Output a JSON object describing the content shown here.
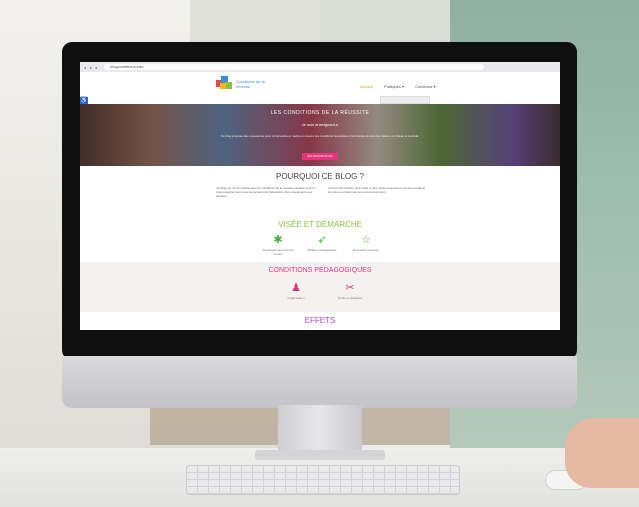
{
  "browser": {
    "url": "blogconditions.edu",
    "controls": "● ● ●"
  },
  "site": {
    "logo_text": "Conditions de la réussite",
    "nav": [
      "Accueil",
      "Pratiques ▾",
      "Contenus ▾"
    ],
    "a11y_icon": "♿"
  },
  "hero": {
    "title": "LES CONDITIONS DE LA RÉUSSITE",
    "subtitle": "Je suis enseignant-e",
    "text": "Ce blog propose des ressources pour comprendre et mettre en œuvre les conditions favorables à la réussite de tous les élèves, en classe et au-delà.",
    "button": "EN SAVOIR PLUS"
  },
  "why": {
    "title": "POURQUOI CE BLOG ?",
    "left_text": "Ce blog est né du constat que les conditions de la réussite scolaire sont un sujet essentiel pour tous les acteurs de l'éducation, des enseignants aux familles.",
    "right_text": "Il réunit des articles, des outils et des pistes concrètes pour accompagner les élèves et favoriser leur épanouissement."
  },
  "vise": {
    "title": "VISÉE ET DÉMARCHE",
    "items": [
      {
        "icon": "✱",
        "label": "Développement de tout enfant"
      },
      {
        "icon": "➶",
        "label": "Relation pédagogique"
      },
      {
        "icon": "☆",
        "label": "Démarche inclusive"
      }
    ]
  },
  "conditions": {
    "title": "CONDITIONS PÉDAGOGIQUES",
    "items": [
      {
        "icon": "♟",
        "label": "Organisation"
      },
      {
        "icon": "✂",
        "label": "Outils et pratiques"
      }
    ]
  },
  "effets": {
    "title": "EFFETS"
  }
}
